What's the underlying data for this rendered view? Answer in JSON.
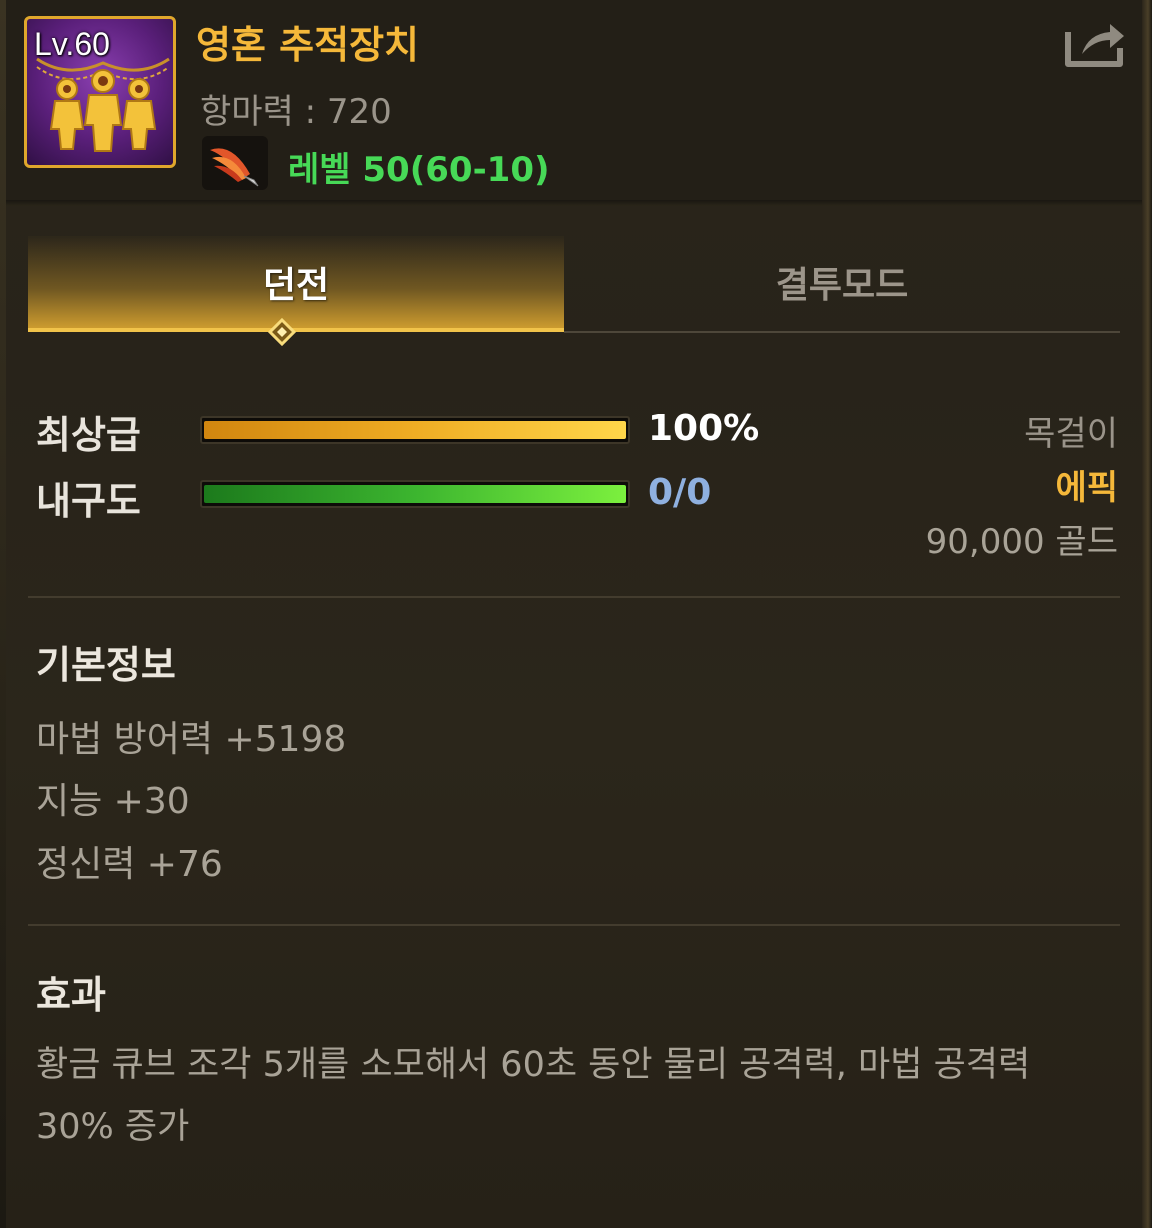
{
  "item": {
    "level_badge": "Lv.60",
    "name": "영혼 추적장치",
    "resist": "항마력 : 720",
    "level_requirement": "레벨 50(60-10)",
    "icon": "soul-tracker-necklace-icon",
    "class_icon": "feather-quill-icon",
    "share_icon": "share-export-icon"
  },
  "tabs": [
    {
      "label": "던전",
      "active": true
    },
    {
      "label": "결투모드",
      "active": false
    }
  ],
  "stats": {
    "grade": {
      "label": "최상급",
      "value_text": "100%",
      "fill_fraction": 1.0,
      "color": "#ffffff"
    },
    "durability": {
      "label": "내구도",
      "value_text": "0/0",
      "fill_fraction": 1.0,
      "color": "#8fb0df"
    }
  },
  "item_meta": {
    "type": "목걸이",
    "rarity": "에픽",
    "rarity_color": "#f5b83a",
    "price": "90,000 골드"
  },
  "basic_info": {
    "title": "기본정보",
    "lines": [
      "마법 방어력 +5198",
      "지능 +30",
      "정신력 +76"
    ]
  },
  "effect": {
    "title": "효과",
    "text": "황금 큐브 조각 5개를 소모해서 60초 동안 물리 공격력, 마법 공격력 30% 증가"
  }
}
